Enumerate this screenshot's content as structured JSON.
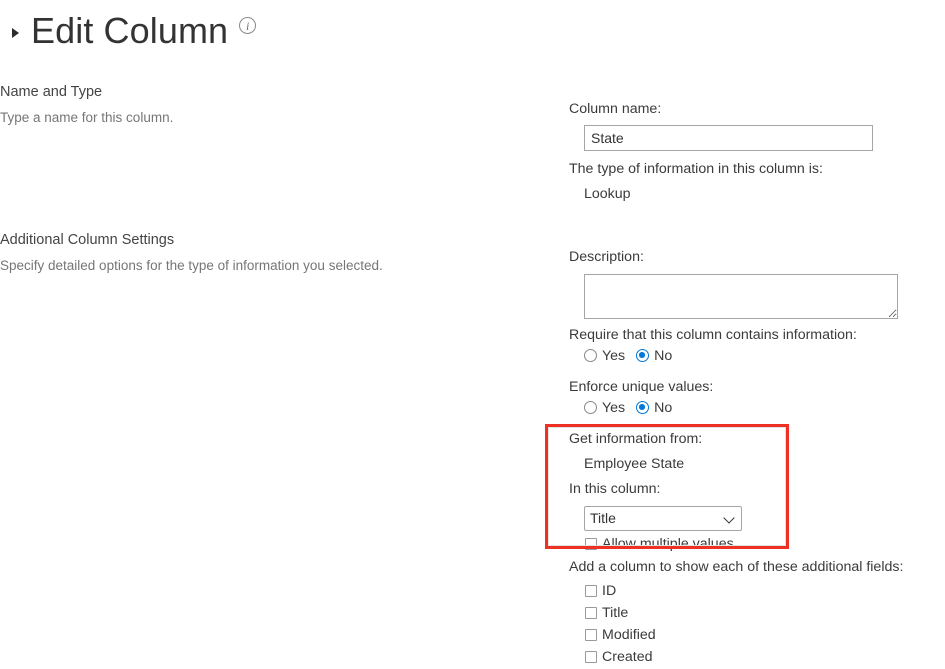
{
  "header": {
    "title": "Edit Column",
    "expand_icon": "triangle-right-icon",
    "info_icon": "info-icon",
    "info_glyph": "i"
  },
  "sections": [
    {
      "heading": "Name and Type",
      "description": "Type a name for this column."
    },
    {
      "heading": "Additional Column Settings",
      "description": "Specify detailed options for the type of information you selected."
    }
  ],
  "form": {
    "column_name_label": "Column name:",
    "column_name_value": "State",
    "type_label": "The type of information in this column is:",
    "type_value": "Lookup",
    "description_label": "Description:",
    "description_value": "",
    "require_label": "Require that this column contains information:",
    "require_options": [
      {
        "label": "Yes",
        "checked": false
      },
      {
        "label": "No",
        "checked": true
      }
    ],
    "enforce_label": "Enforce unique values:",
    "enforce_options": [
      {
        "label": "Yes",
        "checked": false
      },
      {
        "label": "No",
        "checked": true
      }
    ],
    "get_info_label": "Get information from:",
    "get_info_value": "Employee State",
    "in_this_column_label": "In this column:",
    "in_this_column_value": "Title",
    "in_this_column_options": [
      "Title"
    ],
    "allow_multiple_label": "Allow multiple values",
    "allow_multiple_checked": false,
    "additional_fields_label": "Add a column to show each of these additional fields:",
    "additional_fields": [
      {
        "label": "ID",
        "checked": false
      },
      {
        "label": "Title",
        "checked": false
      },
      {
        "label": "Modified",
        "checked": false
      },
      {
        "label": "Created",
        "checked": false
      }
    ]
  },
  "annotation": {
    "highlight_color": "#ee3124"
  }
}
